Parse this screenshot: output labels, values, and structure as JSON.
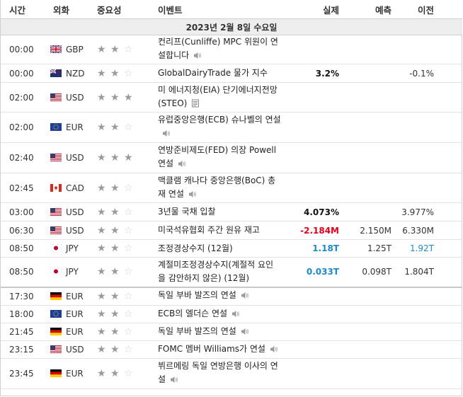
{
  "headers": {
    "time": "시간",
    "currency": "외화",
    "importance": "중요성",
    "event": "이벤트",
    "actual": "실제",
    "forecast": "예측",
    "previous": "이전"
  },
  "date_label": "2023년 2월 8일 수요일",
  "colors": {
    "better": "#1a8bc8",
    "worse": "#e0001b",
    "neutral": "#111111"
  },
  "rows": [
    {
      "time": "00:00",
      "flag": "GB",
      "currency": "GBP",
      "stars": 2,
      "event": "컨리프(Cunliffe) MPC 위원이 연설합니다",
      "icon": "speaker-icon",
      "actual": "",
      "actual_color": "neutral",
      "forecast": "",
      "previous": "",
      "previous_color": "neutral",
      "height": 38
    },
    {
      "time": "00:00",
      "flag": "NZ",
      "currency": "NZD",
      "stars": 2,
      "event": "GlobalDairyTrade 물가 지수",
      "icon": "",
      "actual": "3.2%",
      "actual_color": "neutral",
      "forecast": "",
      "previous": "-0.1%",
      "previous_color": "neutral",
      "height": 26
    },
    {
      "time": "02:00",
      "flag": "US",
      "currency": "USD",
      "stars": 3,
      "event": "미 에너지청(EIA) 단기에너지전망(STEO)",
      "icon": "document-icon",
      "actual": "",
      "actual_color": "neutral",
      "forecast": "",
      "previous": "",
      "previous_color": "neutral",
      "height": 42
    },
    {
      "time": "02:00",
      "flag": "EU",
      "currency": "EUR",
      "stars": 2,
      "event": "유럽중앙은행(ECB) 슈나벨의 연설",
      "icon": "speaker-icon",
      "actual": "",
      "actual_color": "neutral",
      "forecast": "",
      "previous": "",
      "previous_color": "neutral",
      "height": 43
    },
    {
      "time": "02:40",
      "flag": "US",
      "currency": "USD",
      "stars": 3,
      "event": "연방준비제도(FED) 의장 Powell 연설",
      "icon": "speaker-icon",
      "actual": "",
      "actual_color": "neutral",
      "forecast": "",
      "previous": "",
      "previous_color": "neutral",
      "height": 43
    },
    {
      "time": "02:45",
      "flag": "CA",
      "currency": "CAD",
      "stars": 2,
      "event": "맥클램 캐나다 중앙은행(BoC) 총재 연설",
      "icon": "speaker-icon",
      "actual": "",
      "actual_color": "neutral",
      "forecast": "",
      "previous": "",
      "previous_color": "neutral",
      "height": 42
    },
    {
      "time": "03:00",
      "flag": "US",
      "currency": "USD",
      "stars": 2,
      "event": "3년물 국채 입찰",
      "icon": "",
      "actual": "4.073%",
      "actual_color": "neutral",
      "forecast": "",
      "previous": "3.977%",
      "previous_color": "neutral",
      "height": 26
    },
    {
      "time": "06:30",
      "flag": "US",
      "currency": "USD",
      "stars": 2,
      "event": "미국석유협회 주간 원유 재고",
      "icon": "",
      "actual": "-2.184M",
      "actual_color": "worse",
      "forecast": "2.150M",
      "previous": "6.330M",
      "previous_color": "neutral",
      "height": 26
    },
    {
      "time": "08:50",
      "flag": "JP",
      "currency": "JPY",
      "stars": 2,
      "event": "조정경상수지 (12월)",
      "icon": "",
      "actual": "1.18T",
      "actual_color": "better",
      "forecast": "1.25T",
      "previous": "1.92T",
      "previous_color": "better",
      "height": 25
    },
    {
      "time": "08:50",
      "flag": "JP",
      "currency": "JPY",
      "stars": 2,
      "event": "계절미조정경상수지(계절적 요인을 감안하지 않은) (12월)",
      "icon": "",
      "actual": "0.033T",
      "actual_color": "better",
      "forecast": "0.098T",
      "previous": "1.804T",
      "previous_color": "neutral",
      "height": 42,
      "separator": true
    },
    {
      "time": "17:30",
      "flag": "DE",
      "currency": "EUR",
      "stars": 2,
      "event": "독일 부바 발즈의 연설",
      "icon": "speaker-icon",
      "actual": "",
      "actual_color": "neutral",
      "forecast": "",
      "previous": "",
      "previous_color": "neutral",
      "height": 26
    },
    {
      "time": "18:00",
      "flag": "EU",
      "currency": "EUR",
      "stars": 2,
      "event": "ECB의 엘더슨 연설",
      "icon": "speaker-icon",
      "actual": "",
      "actual_color": "neutral",
      "forecast": "",
      "previous": "",
      "previous_color": "neutral",
      "height": 25
    },
    {
      "time": "21:45",
      "flag": "DE",
      "currency": "EUR",
      "stars": 2,
      "event": "독일 부바 발즈의 연설",
      "icon": "speaker-icon",
      "actual": "",
      "actual_color": "neutral",
      "forecast": "",
      "previous": "",
      "previous_color": "neutral",
      "height": 25
    },
    {
      "time": "23:15",
      "flag": "US",
      "currency": "USD",
      "stars": 2,
      "event": "FOMC 멤버 Williams가 연설",
      "icon": "speaker-icon",
      "actual": "",
      "actual_color": "neutral",
      "forecast": "",
      "previous": "",
      "previous_color": "neutral",
      "height": 25
    },
    {
      "time": "23:45",
      "flag": "DE",
      "currency": "EUR",
      "stars": 2,
      "event": "뷔르메링 독일 연방은행 이사의 연설",
      "icon": "speaker-icon",
      "actual": "",
      "actual_color": "neutral",
      "forecast": "",
      "previous": "",
      "previous_color": "neutral",
      "height": 43
    }
  ]
}
